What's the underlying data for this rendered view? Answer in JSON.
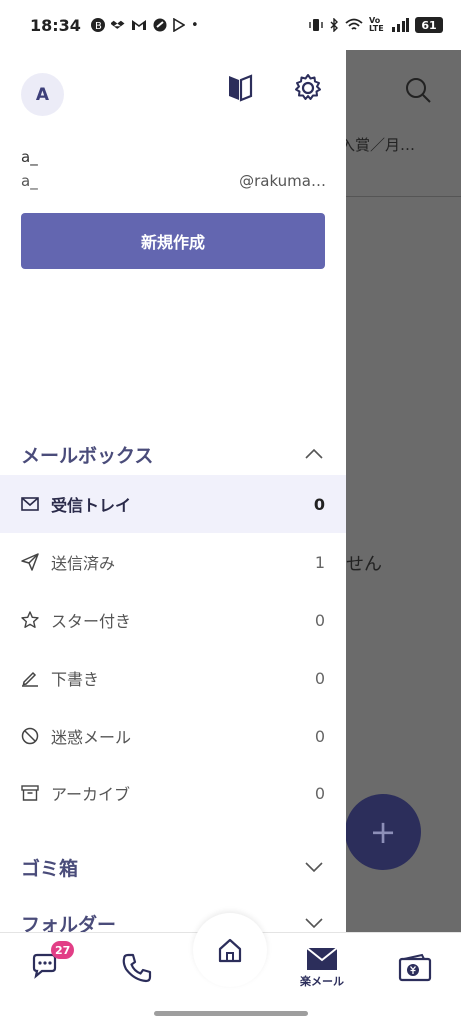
{
  "status_bar": {
    "time": "18:34",
    "notification_icons": [
      "b-icon",
      "dropbox-icon",
      "gmail-icon",
      "maps-icon",
      "play-icon"
    ],
    "dot": "•",
    "volte": "Vo LTE",
    "battery": "61"
  },
  "background": {
    "tab_text": "入賞／月…",
    "empty_text": "せん"
  },
  "drawer": {
    "avatar_initial": "A",
    "account_name": "a_",
    "account_local": "a_",
    "account_domain": "@rakuma…",
    "new_button_label": "新規作成",
    "mailbox_section_label": "メールボックス",
    "mailboxes": [
      {
        "name": "受信トレイ",
        "count": "0",
        "icon": "inbox-icon",
        "active": true
      },
      {
        "name": "送信済み",
        "count": "1",
        "icon": "send-icon",
        "active": false
      },
      {
        "name": "スター付き",
        "count": "0",
        "icon": "star-icon",
        "active": false
      },
      {
        "name": "下書き",
        "count": "0",
        "icon": "pencil-icon",
        "active": false
      },
      {
        "name": "迷惑メール",
        "count": "0",
        "icon": "spam-icon",
        "active": false
      },
      {
        "name": "アーカイブ",
        "count": "0",
        "icon": "archive-icon",
        "active": false
      }
    ],
    "trash_label": "ゴミ箱",
    "folder_label": "フォルダー"
  },
  "bottom_nav": {
    "chat_badge": "27",
    "mail_label": "楽メール"
  },
  "colors": {
    "accent": "#6366b0",
    "navy": "#2c2e5b",
    "badge": "#e23e86",
    "active_bg": "#f1f1fb"
  }
}
